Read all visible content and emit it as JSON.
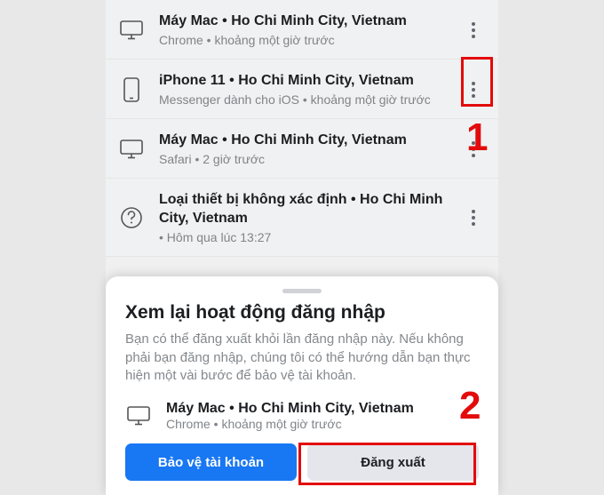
{
  "sessions": [
    {
      "title": "Máy Mac • Ho Chi Minh City, Vietnam",
      "sub": "Chrome • khoảng một giờ trước",
      "icon": "desktop"
    },
    {
      "title": "iPhone 11 • Ho Chi Minh City, Vietnam",
      "sub": "Messenger dành cho iOS • khoảng một giờ trước",
      "icon": "phone"
    },
    {
      "title": "Máy Mac • Ho Chi Minh City, Vietnam",
      "sub": "Safari • 2 giờ trước",
      "icon": "desktop"
    },
    {
      "title": "Loại thiết bị không xác định • Ho Chi Minh City, Vietnam",
      "sub": " • Hôm qua lúc 13:27",
      "icon": "unknown"
    }
  ],
  "sheet": {
    "title": "Xem lại hoạt động đăng nhập",
    "desc": "Bạn có thể đăng xuất khỏi lần đăng nhập này. Nếu không phải bạn đăng nhập, chúng tôi có thể hướng dẫn bạn thực hiện một vài bước để bảo vệ tài khoản.",
    "device_title": "Máy Mac • Ho Chi Minh City, Vietnam",
    "device_sub": "Chrome • khoảng một giờ trước",
    "btn_primary": "Bảo vệ tài khoản",
    "btn_secondary": "Đăng xuất"
  },
  "annotations": {
    "num1": "1",
    "num2": "2"
  }
}
